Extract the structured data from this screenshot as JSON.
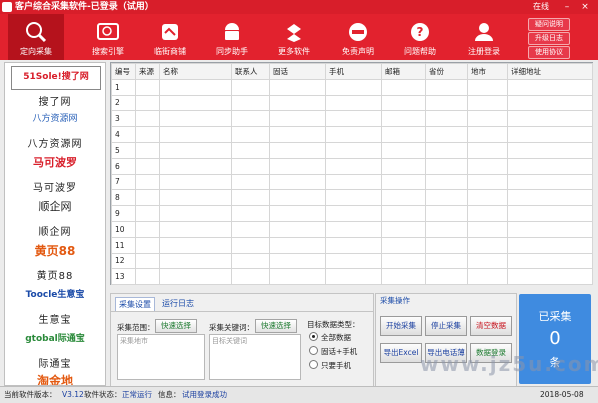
{
  "window": {
    "title": "客户综合采集软件-已登录（试用）",
    "online_label": "在线",
    "minimize": "–",
    "close": "×"
  },
  "toolbar": [
    {
      "label": "定向采集",
      "icon": "target-icon"
    },
    {
      "label": "搜索引擎",
      "icon": "search-engine-icon"
    },
    {
      "label": "临街商铺",
      "icon": "store-icon"
    },
    {
      "label": "同步助手",
      "icon": "android-icon"
    },
    {
      "label": "更多软件",
      "icon": "dropbox-icon"
    },
    {
      "label": "免责声明",
      "icon": "no-entry-icon"
    },
    {
      "label": "问题帮助",
      "icon": "help-icon"
    },
    {
      "label": "注册登录",
      "icon": "user-icon"
    }
  ],
  "side_buttons": [
    "疑问说明",
    "升级日志",
    "使用协议"
  ],
  "sites": [
    {
      "logo": "51Sole!搜了网",
      "name": "搜了网"
    },
    {
      "logo": "八方资源网",
      "name": "八方资源网"
    },
    {
      "logo": "马可波罗",
      "name": "马可波罗"
    },
    {
      "logo": "顺企网",
      "name": "顺企网"
    },
    {
      "logo": "黄页88",
      "name": "黄页88"
    },
    {
      "logo": "Toocle生意宝",
      "name": "生意宝"
    },
    {
      "logo": "gtobal际通宝",
      "name": "际通宝"
    },
    {
      "logo": "淘金地",
      "name": ""
    }
  ],
  "table": {
    "headers": [
      "编号",
      "来源",
      "名称",
      "联系人",
      "固话",
      "手机",
      "邮箱",
      "省份",
      "地市",
      "详细地址"
    ],
    "rows": [
      "1",
      "2",
      "3",
      "4",
      "5",
      "6",
      "7",
      "8",
      "9",
      "10",
      "11",
      "12",
      "13"
    ]
  },
  "panel": {
    "tab_settings": "采集设置",
    "tab_log": "运行日志",
    "range_label": "采集范围：",
    "range_button": "快速选择",
    "range_placeholder": "采集地市",
    "keyword_label": "采集关键词：",
    "keyword_button": "快速选择",
    "keyword_placeholder": "目标关键词",
    "target_type_label": "目标数据类型：",
    "options": [
      "全部数据",
      "固话+手机",
      "只要手机"
    ],
    "selected_option": "全部数据"
  },
  "ops": {
    "header": "采集操作",
    "start": "开始采集",
    "stop": "停止采集",
    "clear": "清空数据",
    "export_excel": "导出Excel",
    "export_phonebook": "导出电话薄",
    "data_login": "数据登录"
  },
  "counter": {
    "label": "已采集",
    "count": "0",
    "unit": "条"
  },
  "status": {
    "version_label": "当前软件版本：",
    "version": "V3.12",
    "state_label": "软件状态：",
    "state": "正常运行",
    "info_label": "信息：",
    "info": "试用登录成功",
    "date": "2018-05-08"
  },
  "watermark": "www.jz5u.com",
  "colors": {
    "brand_red": "#e2222e",
    "counter_blue": "#3f8be0"
  }
}
